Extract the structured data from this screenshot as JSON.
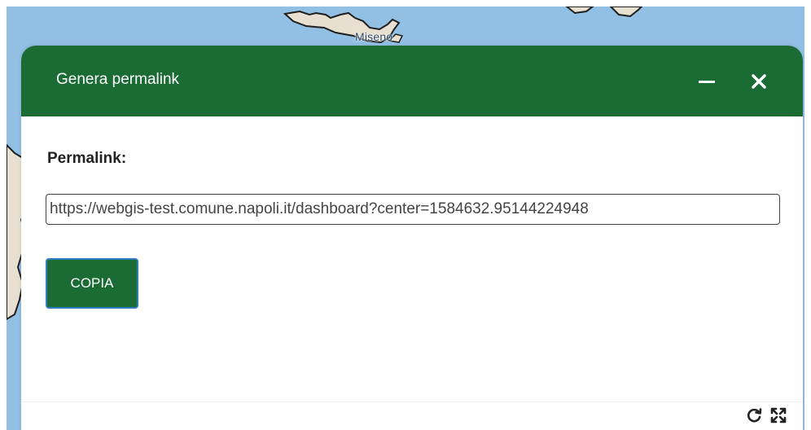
{
  "map": {
    "place_label": "Miseno"
  },
  "dialog": {
    "title": "Genera permalink",
    "permalink_label": "Permalink:",
    "permalink_value": "https://webgis-test.comune.napoli.it/dashboard?center=1584632.95144224948",
    "copy_label": "COPIA"
  },
  "icons": {
    "minimize": "minimize-icon",
    "close": "close-icon",
    "refresh": "refresh-icon",
    "expand": "expand-icon"
  },
  "colors": {
    "header_bg": "#1a6b34",
    "button_bg": "#1a6b34",
    "button_border": "#2d7fc2",
    "sea": "#92bfe4",
    "land": "#e7dfcf"
  }
}
